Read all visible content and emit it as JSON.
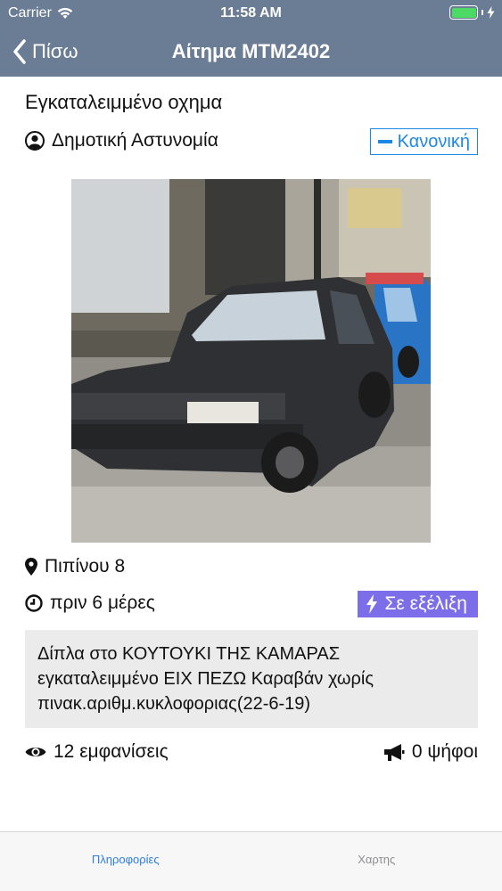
{
  "status_bar": {
    "carrier": "Carrier",
    "time": "11:58 AM"
  },
  "nav": {
    "back_label": "Πίσω",
    "title": "Αίτημα MTM2402"
  },
  "request": {
    "title": "Εγκαταλειμμένο οχημα",
    "department": "Δημοτική Αστυνομία",
    "priority": "Κανονική",
    "address": "Πιπίνου 8",
    "time_ago": "πριν 6 μέρες",
    "status": "Σε εξέλιξη",
    "description": "Δίπλα στο ΚΟΥΤΟΥΚΙ ΤΗΣ ΚΑΜΑΡΑΣ εγκαταλειμμένο ΕΙΧ ΠΕΖΩ Καραβάν χωρίς πινακ.αριθμ.κυκλοφοριας(22-6-19)",
    "views": "12 εμφανίσεις",
    "votes": "0 ψήφοι"
  },
  "tabs": {
    "info": "Πληροφορίες",
    "map": "Χαρτης"
  },
  "colors": {
    "nav": "#6b7d95",
    "accent": "#1e88e5",
    "status": "#7c6ee8",
    "tab_active": "#2f7ee0"
  }
}
